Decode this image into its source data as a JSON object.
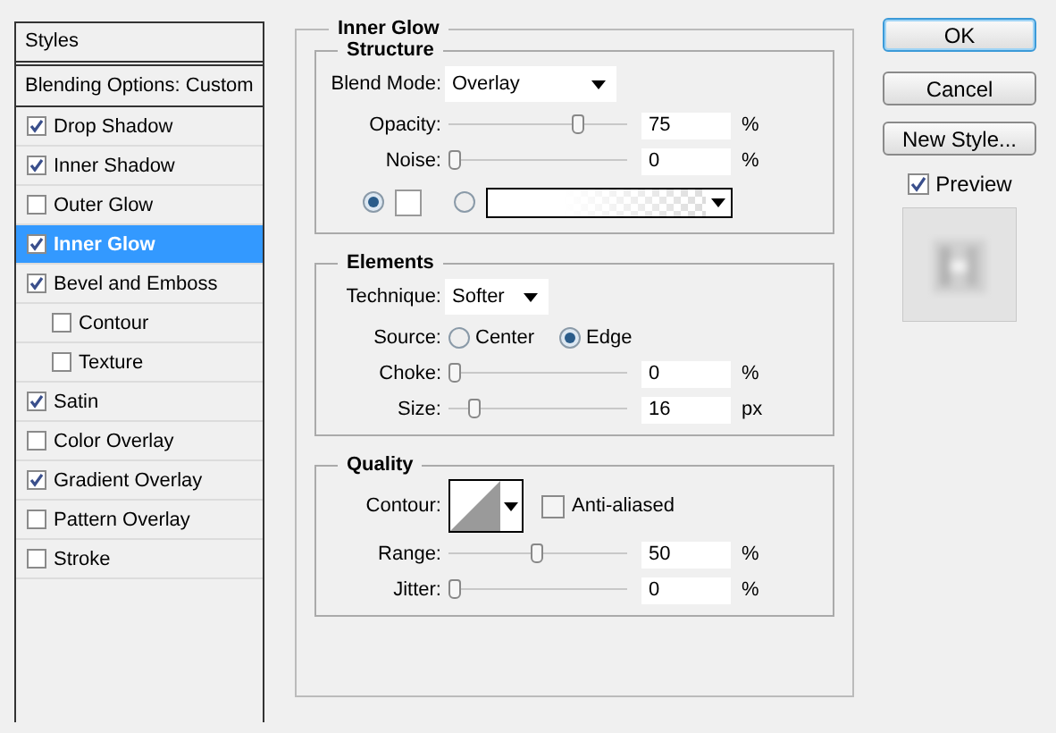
{
  "styles_panel": {
    "title": "Styles",
    "blending_options": "Blending Options: Custom",
    "items": [
      {
        "label": "Drop Shadow",
        "checked": true,
        "selected": false
      },
      {
        "label": "Inner Shadow",
        "checked": true,
        "selected": false
      },
      {
        "label": "Outer Glow",
        "checked": false,
        "selected": false
      },
      {
        "label": "Inner Glow",
        "checked": true,
        "selected": true
      },
      {
        "label": "Bevel and Emboss",
        "checked": true,
        "selected": false,
        "children": [
          {
            "label": "Contour",
            "checked": false,
            "selected": false
          },
          {
            "label": "Texture",
            "checked": false,
            "selected": false
          }
        ]
      },
      {
        "label": "Satin",
        "checked": true,
        "selected": false
      },
      {
        "label": "Color Overlay",
        "checked": false,
        "selected": false
      },
      {
        "label": "Gradient Overlay",
        "checked": true,
        "selected": false
      },
      {
        "label": "Pattern Overlay",
        "checked": false,
        "selected": false
      },
      {
        "label": "Stroke",
        "checked": false,
        "selected": false
      }
    ]
  },
  "inner_glow": {
    "title": "Inner Glow",
    "structure": {
      "title": "Structure",
      "blend_mode": {
        "label": "Blend Mode:",
        "value": "Overlay"
      },
      "sliders": [
        {
          "label": "Opacity:",
          "level": 0.75,
          "value": "75",
          "unit": "%"
        },
        {
          "label": "Noise:",
          "level": 0,
          "value": "0",
          "unit": "%"
        }
      ],
      "fill_options": [
        {
          "kind": "color",
          "selected": true
        },
        {
          "kind": "gradient",
          "selected": false
        }
      ]
    },
    "elements": {
      "title": "Elements",
      "technique": {
        "label": "Technique:",
        "value": "Softer"
      },
      "source": {
        "label": "Source:",
        "options": [
          {
            "label": "Center",
            "selected": false
          },
          {
            "label": "Edge",
            "selected": true
          }
        ]
      },
      "sliders": [
        {
          "label": "Choke:",
          "level": 0,
          "value": "0",
          "unit": "%"
        },
        {
          "label": "Size:",
          "level": 0.12,
          "value": "16",
          "unit": "px"
        }
      ]
    },
    "quality": {
      "title": "Quality",
      "contour_label": "Contour:",
      "anti_aliased": {
        "label": "Anti-aliased",
        "checked": false
      },
      "sliders": [
        {
          "label": "Range:",
          "level": 0.5,
          "value": "50",
          "unit": "%"
        },
        {
          "label": "Jitter:",
          "level": 0,
          "value": "0",
          "unit": "%"
        }
      ]
    }
  },
  "buttons": [
    {
      "label": "OK",
      "kind": "default"
    },
    {
      "label": "Cancel",
      "kind": "normal"
    },
    {
      "label": "New Style...",
      "kind": "normal"
    }
  ],
  "preview": {
    "label": "Preview",
    "checked": true
  }
}
